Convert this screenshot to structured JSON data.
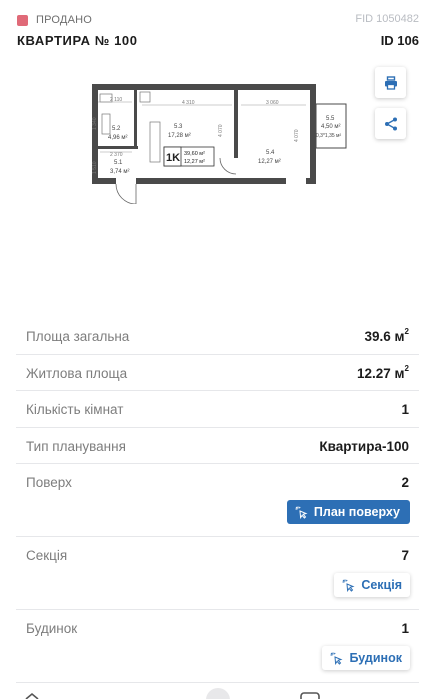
{
  "header": {
    "status": "ПРОДАНО",
    "fid": "FID 1050482",
    "title": "КВАРТИРА № 100",
    "id": "ID 106"
  },
  "colors": {
    "status_sold": "#e06a78",
    "accent": "#2d6fb5"
  },
  "icons": {
    "print": "printer-icon",
    "share": "share-icon",
    "cursor": "cursor-click-icon"
  },
  "floorplan": {
    "badge_type": "1K",
    "badge_total": "39,60 м²",
    "badge_living": "12,27 м²",
    "rooms": [
      {
        "num": "5.1",
        "area": "3,74 м²"
      },
      {
        "num": "5.2",
        "area": "4,96 м²"
      },
      {
        "num": "5.3",
        "area": "17,28 м²"
      },
      {
        "num": "5.4",
        "area": "12,27 м²"
      },
      {
        "num": "5.5",
        "area": "4,50 м²",
        "note": "0,3*1,35 м²"
      }
    ],
    "dims": {
      "d1": "2 110",
      "d2": "4 310",
      "d3": "3 060",
      "d4": "2 370",
      "d5": "4 070",
      "d6": "4 070",
      "d7": "1 510",
      "d8": "1 340"
    }
  },
  "properties": {
    "total_area": {
      "label": "Площа загальна",
      "value": "39.6 м",
      "unit_sup": "2"
    },
    "living_area": {
      "label": "Житлова площа",
      "value": "12.27 м",
      "unit_sup": "2"
    },
    "rooms": {
      "label": "Кількість кімнат",
      "value": "1"
    },
    "layout": {
      "label": "Тип планування",
      "value": "Квартира-100"
    },
    "floor": {
      "label": "Поверх",
      "value": "2",
      "button": "План поверху"
    },
    "section": {
      "label": "Секція",
      "value": "7",
      "button": "Секція"
    },
    "building": {
      "label": "Будинок",
      "value": "1",
      "button": "Будинок"
    }
  }
}
